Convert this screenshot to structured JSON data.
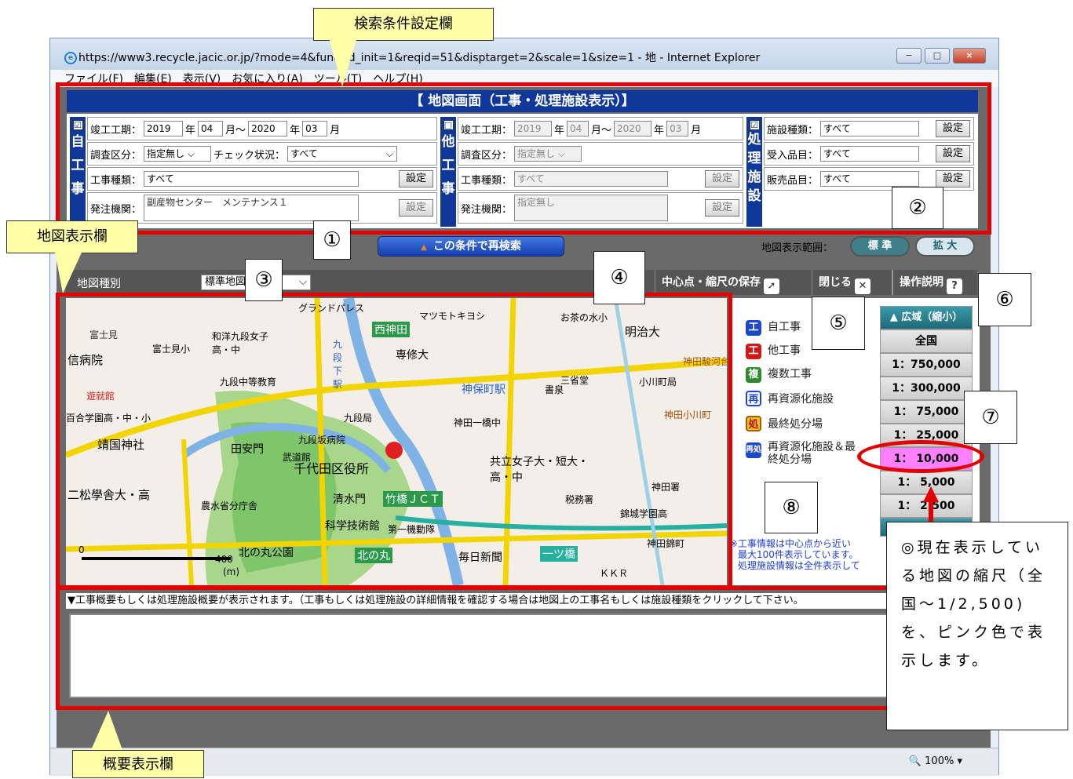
{
  "window": {
    "title": "https://www3.recycle.jacic.or.jp/?mode=4&func_id_init=1&reqid=51&disptarget=2&scale=1&size=1 - 地 - Internet Explorer",
    "controls": [
      "−",
      "□",
      "×"
    ],
    "zoom": "100%"
  },
  "menu": [
    "ファイル(F)",
    "編集(E)",
    "表示(V)",
    "お気に入り(A)",
    "ツール(T)",
    "ヘルプ(H)"
  ],
  "header": "【 地図画面（工事・処理施設表示）】",
  "self_work": {
    "label": "自工事",
    "checked": "☑",
    "period_label": "竣工工期：",
    "from_year": "2019",
    "year_unit": "年",
    "from_month": "04",
    "month_unit": "月",
    "tilde": "～",
    "to_year": "2020",
    "to_month": "03",
    "survey_label": "調査区分：",
    "survey_value": "指定無し",
    "check_label": "チェック状況：",
    "check_value": "すべて",
    "type_label": "工事種類：",
    "type_value": "すべて",
    "order_label": "発注機関：",
    "order_value": "副産物センター　メンテナンス１",
    "set": "設定"
  },
  "other_work": {
    "label": "他工事",
    "checked": "□",
    "period_label": "竣工工期：",
    "from_year": "2019",
    "from_month": "04",
    "to_year": "2020",
    "to_month": "03",
    "survey_label": "調査区分：",
    "survey_value": "指定無し",
    "type_label": "工事種類：",
    "type_value": "すべて",
    "order_label": "発注機関：",
    "order_value": "指定無し",
    "set": "設定"
  },
  "facility": {
    "label": "処理施設",
    "checked": "☑",
    "kind_label": "施設種類：",
    "kind_value": "すべて",
    "accept_label": "受入品目：",
    "accept_value": "すべて",
    "sale_label": "販売品目：",
    "sale_value": "すべて",
    "set": "設定"
  },
  "research_button": "この条件で再検索",
  "map_range": {
    "label": "地図表示範囲：",
    "standard": "標 準",
    "expand": "拡 大"
  },
  "map_toolbar": {
    "type_label": "地図種別",
    "type_value": "標準地図",
    "save_center": "中心点・縮尺の保存",
    "close": "閉じる",
    "help": "操作説明"
  },
  "map": {
    "labels": [
      "富士見",
      "信病院",
      "富士見小",
      "和洋九段女子高・中",
      "専修大",
      "九段中等教育",
      "西神田",
      "九段下駅",
      "神保町駅",
      "神田一橋中",
      "お茶の水小",
      "明治大",
      "小川町局",
      "書泉",
      "九段局",
      "百合学園高・中・小",
      "靖国神社",
      "田安門",
      "武道館",
      "九段坂病院",
      "千代田区役所",
      "共立女子大・短大・高・中",
      "神田署",
      "税務署",
      "錦城学園高",
      "二松學舎大・高",
      "農水省分庁舎",
      "清水門",
      "竹橋ＪＣＴ",
      "科学技術館",
      "第一機動隊",
      "北の丸公園",
      "北の丸",
      "毎日新聞",
      "一ツ橋",
      "神田錦町",
      "ＫＫＲ",
      "遊就館",
      "マツモトキヨシ",
      "グランドパレス",
      "神田駿河台",
      "神田小川町",
      "三省堂"
    ],
    "scale_0": "0",
    "scale_400": "400",
    "scale_unit": "(m)"
  },
  "legend": [
    {
      "icon": "工",
      "label": "自工事",
      "color": "#1d48c8"
    },
    {
      "icon": "工",
      "label": "他工事",
      "color": "#d01818"
    },
    {
      "icon": "複",
      "label": "複数工事",
      "color": "#2d8a2d"
    },
    {
      "icon": "再",
      "label": "再資源化施設",
      "color": "#1d48c8"
    },
    {
      "icon": "処",
      "label": "最終処分場",
      "color": "#e0a000"
    },
    {
      "icon": "再処",
      "label": "再資源化施設＆最終処分場",
      "color": "#1d48c8"
    }
  ],
  "scale_panel": {
    "wide": "▲ 広域（縮小）",
    "items": [
      "全国",
      "1：750,000",
      "1：300,000",
      "1： 75,000",
      "1： 25,000",
      "1： 10,000",
      "1：  5,000",
      "1：  2,500"
    ],
    "selected": "1： 10,000"
  },
  "note": [
    "※工事情報は中心点から近い",
    "最大100件表示しています。",
    "処理施設情報は全件表示して"
  ],
  "outline_text": "▼工事概要もしくは処理施設概要が表示されます。（工事もしくは処理施設の詳細情報を確認する場合は地図上の工事名もしくは施設種類をクリックして下さい。",
  "callouts": {
    "search": "検索条件設定欄",
    "map": "地図表示欄",
    "outline": "概要表示欄",
    "nums": [
      "①",
      "②",
      "③",
      "④",
      "⑤",
      "⑥",
      "⑦",
      "⑧"
    ],
    "pink": "◎現在表示している地図の縮尺（全国～1/2,500)を、ピンク色で表示します。"
  },
  "colors": {
    "navy": "#10379a",
    "red": "#e20000",
    "pink": "#ff80ff",
    "callout": "#ffffa8"
  }
}
